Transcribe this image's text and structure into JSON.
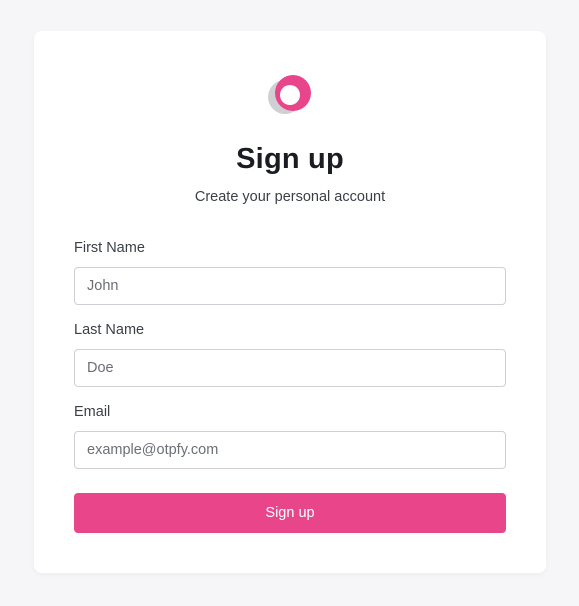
{
  "brand": {
    "logo_icon": "ring-logo-icon",
    "accent_color": "#e8458b",
    "secondary_color": "#cfcfd4"
  },
  "header": {
    "title": "Sign up",
    "subtitle": "Create your personal account"
  },
  "form": {
    "first_name": {
      "label": "First Name",
      "value": "",
      "placeholder": "John"
    },
    "last_name": {
      "label": "Last Name",
      "value": "",
      "placeholder": "Doe"
    },
    "email": {
      "label": "Email",
      "value": "",
      "placeholder": "example@otpfy.com"
    },
    "submit_label": "Sign up"
  }
}
